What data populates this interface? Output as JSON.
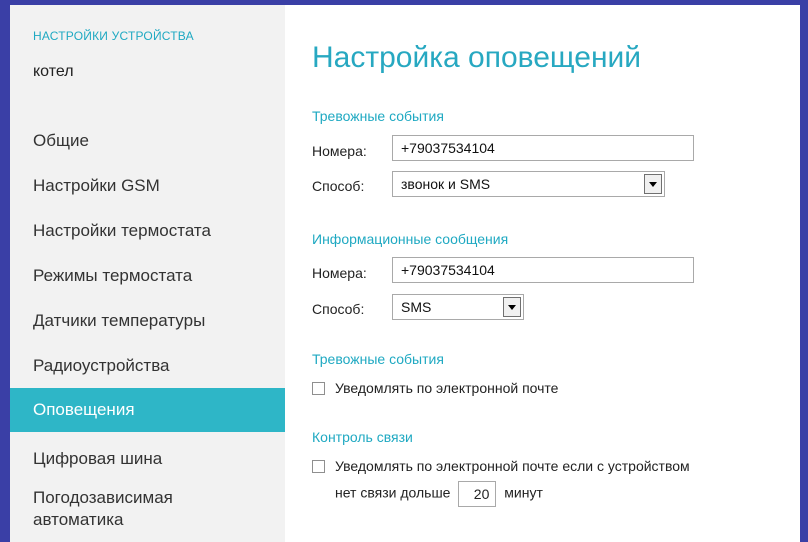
{
  "sidebar": {
    "section_label": "НАСТРОЙКИ УСТРОЙСТВА",
    "device_name": "котел",
    "items": [
      {
        "label": "Общие"
      },
      {
        "label": "Настройки GSM"
      },
      {
        "label": "Настройки термостата"
      },
      {
        "label": "Режимы термостата"
      },
      {
        "label": "Датчики температуры"
      },
      {
        "label": "Радиоустройства"
      },
      {
        "label": "Оповещения",
        "active": true
      },
      {
        "label": "Цифровая шина"
      },
      {
        "label_line1": "Погодозависимая",
        "label_line2": "автоматика"
      }
    ]
  },
  "main": {
    "title": "Настройка оповещений",
    "alarm_events": {
      "title": "Тревожные события",
      "numbers_label": "Номера:",
      "numbers_value": "+79037534104",
      "method_label": "Способ:",
      "method_value": "звонок и SMS"
    },
    "info_messages": {
      "title": "Информационные сообщения",
      "numbers_label": "Номера:",
      "numbers_value": "+79037534104",
      "method_label": "Способ:",
      "method_value": "SMS"
    },
    "alarm_email": {
      "title": "Тревожные события",
      "checkbox_label": "Уведомлять по электронной почте",
      "checked": false
    },
    "connection_control": {
      "title": "Контроль связи",
      "checkbox_label_line1": "Уведомлять по электронной почте если с устройством",
      "line2_prefix": "нет связи дольше",
      "minutes_value": "20",
      "line2_suffix": "минут",
      "checked": false
    }
  },
  "colors": {
    "accent": "#2eb6c7",
    "frame": "#3a3fa6",
    "sidebar_bg": "#f2f2f2"
  }
}
